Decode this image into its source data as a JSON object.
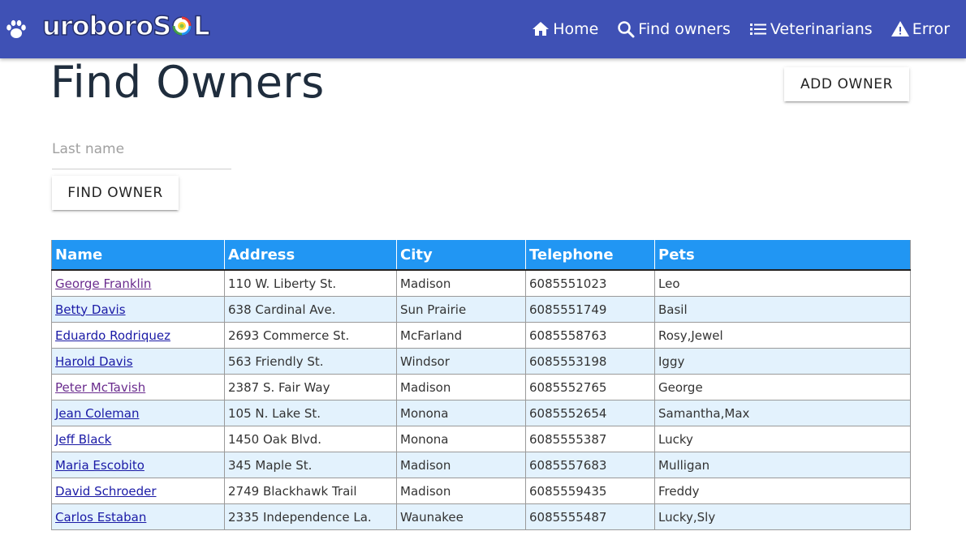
{
  "brand": {
    "name": "uroboroSQL",
    "prefix": "uroboro",
    "suffix": "S",
    "suffix2": "L"
  },
  "nav": [
    {
      "label": "Home",
      "icon": "home-icon"
    },
    {
      "label": "Find owners",
      "icon": "search-icon"
    },
    {
      "label": "Veterinarians",
      "icon": "list-icon"
    },
    {
      "label": "Error",
      "icon": "warning-icon"
    }
  ],
  "page": {
    "title": "Find Owners",
    "add_owner_label": "ADD OWNER",
    "find_owner_label": "FIND OWNER",
    "last_name_placeholder": "Last name",
    "last_name_value": ""
  },
  "table": {
    "headers": [
      "Name",
      "Address",
      "City",
      "Telephone",
      "Pets"
    ],
    "rows": [
      {
        "name": "George Franklin",
        "address": "110 W. Liberty St.",
        "city": "Madison",
        "telephone": "6085551023",
        "pets": "Leo"
      },
      {
        "name": "Betty Davis",
        "address": "638 Cardinal Ave.",
        "city": "Sun Prairie",
        "telephone": "6085551749",
        "pets": "Basil"
      },
      {
        "name": "Eduardo Rodriquez",
        "address": "2693 Commerce St.",
        "city": "McFarland",
        "telephone": "6085558763",
        "pets": "Rosy,Jewel"
      },
      {
        "name": "Harold Davis",
        "address": "563 Friendly St.",
        "city": "Windsor",
        "telephone": "6085553198",
        "pets": "Iggy"
      },
      {
        "name": "Peter McTavish",
        "address": "2387 S. Fair Way",
        "city": "Madison",
        "telephone": "6085552765",
        "pets": "George"
      },
      {
        "name": "Jean Coleman",
        "address": "105 N. Lake St.",
        "city": "Monona",
        "telephone": "6085552654",
        "pets": "Samantha,Max"
      },
      {
        "name": "Jeff Black",
        "address": "1450 Oak Blvd.",
        "city": "Monona",
        "telephone": "6085555387",
        "pets": "Lucky"
      },
      {
        "name": "Maria Escobito",
        "address": "345 Maple St.",
        "city": "Madison",
        "telephone": "6085557683",
        "pets": "Mulligan"
      },
      {
        "name": "David Schroeder",
        "address": "2749 Blackhawk Trail",
        "city": "Madison",
        "telephone": "6085559435",
        "pets": "Freddy"
      },
      {
        "name": "Carlos Estaban",
        "address": "2335 Independence La.",
        "city": "Waunakee",
        "telephone": "6085555487",
        "pets": "Lucky,Sly"
      }
    ]
  },
  "colors": {
    "navbar": "#3f51b5",
    "table_header": "#2196f3",
    "row_alt": "#e3f2fd",
    "link": "#1a1aa6"
  }
}
